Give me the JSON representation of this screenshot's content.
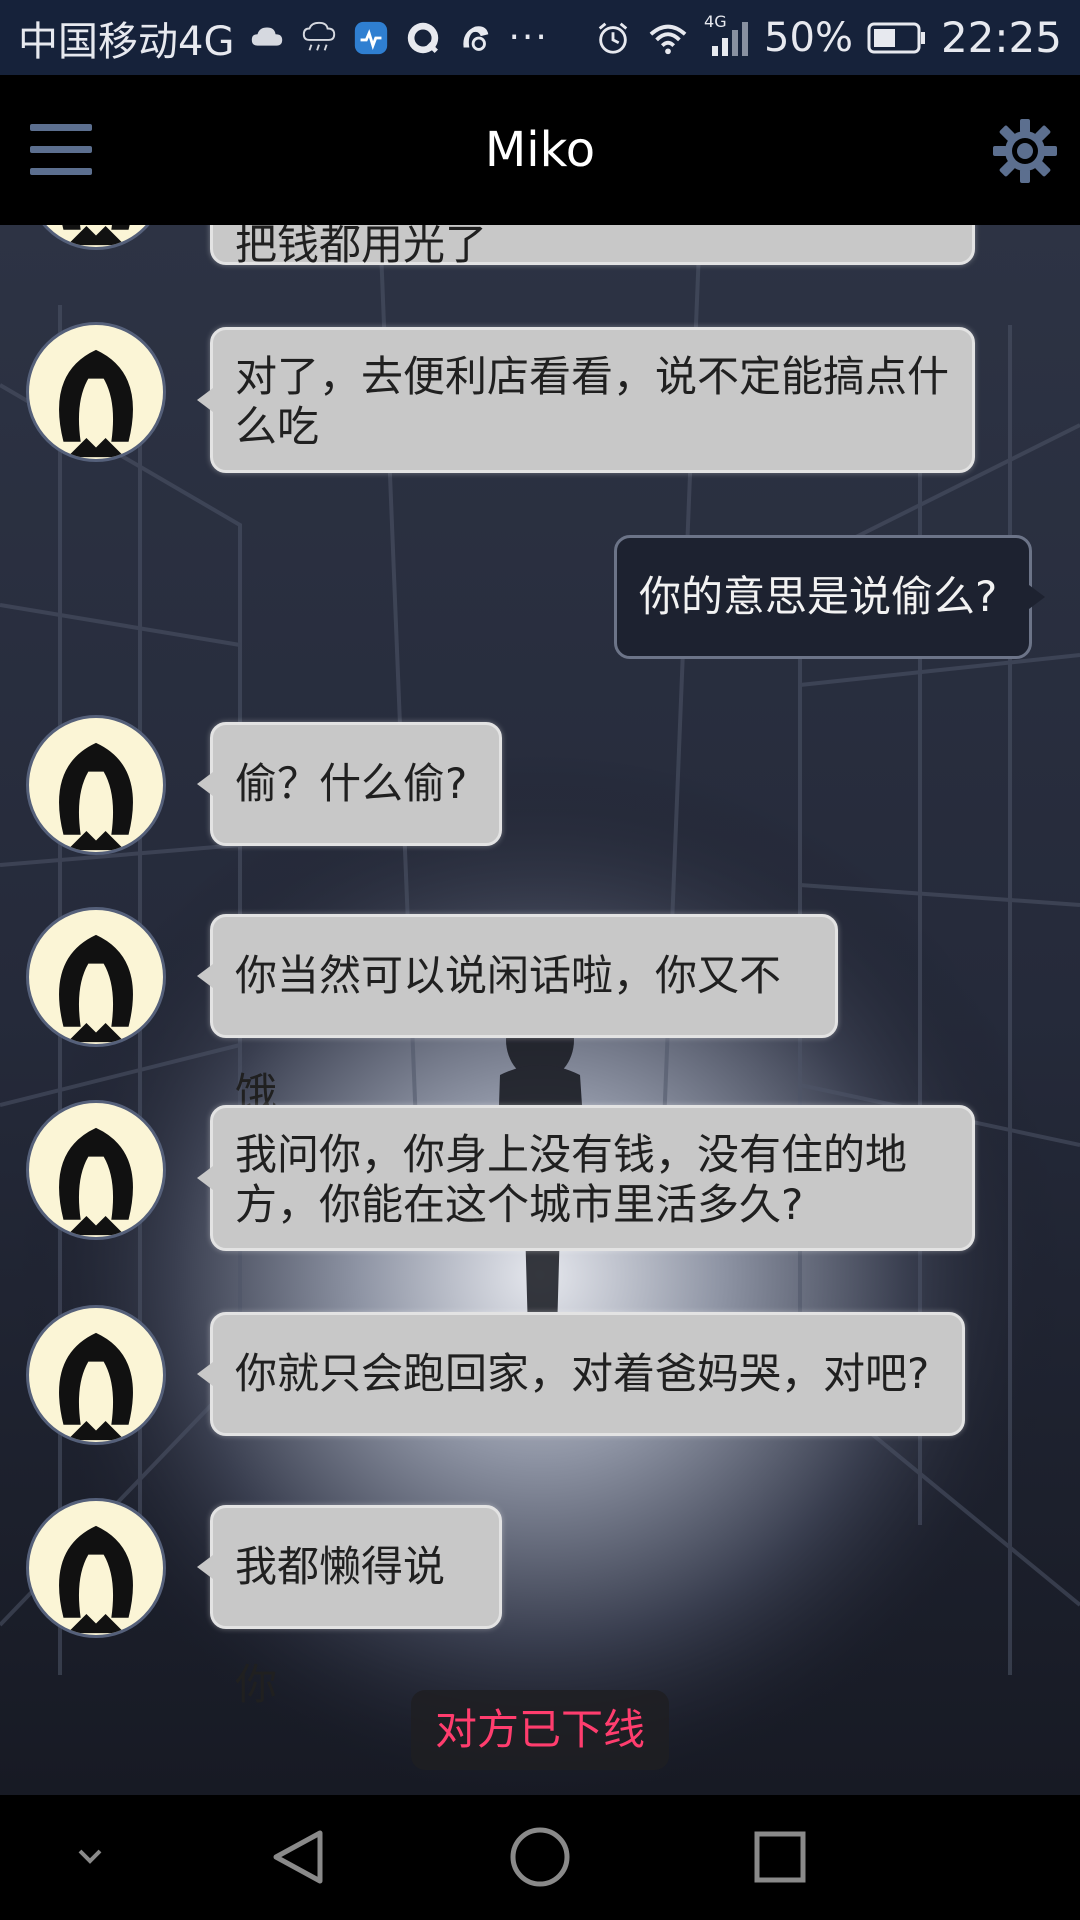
{
  "status_bar": {
    "carrier": "中国移动4G",
    "network": "4G",
    "battery": "50%",
    "time": "22:25",
    "icons": [
      "cloud-icon",
      "rain-icon",
      "health-app-icon",
      "qq-icon",
      "browser-icon",
      "more-icon",
      "alarm-icon",
      "wifi-icon",
      "signal-icon",
      "battery-icon"
    ]
  },
  "header": {
    "title": "Miko",
    "menu_icon": "hamburger-menu-icon",
    "settings_icon": "gear-icon"
  },
  "messages": [
    {
      "side": "in",
      "text": "把钱都用光了",
      "partial": true
    },
    {
      "side": "in",
      "text": "对了，去便利店看看，说不定能搞点什么吃"
    },
    {
      "side": "out",
      "text": "你的意思是说偷么?"
    },
    {
      "side": "in",
      "text": "偷？什么偷?"
    },
    {
      "side": "in",
      "text": "你当然可以说闲话啦，你又不饿"
    },
    {
      "side": "in",
      "text": "我问你，你身上没有钱，没有住的地方，你能在这个城市里活多久?"
    },
    {
      "side": "in",
      "text": "你就只会跑回家，对着爸妈哭，对吧?"
    },
    {
      "side": "in",
      "text": "我都懒得说你"
    }
  ],
  "status_message": "对方已下线",
  "nav": {
    "icons": [
      "collapse-icon",
      "back-icon",
      "home-icon",
      "recents-icon"
    ]
  },
  "colors": {
    "status_bar_bg": "#16223a",
    "header_bg": "#000000",
    "incoming_bubble": "#c8c8c8",
    "outgoing_bubble": "#1d2230",
    "offline_text": "#ff3d6e",
    "icon_accent": "#5c6f8f"
  }
}
